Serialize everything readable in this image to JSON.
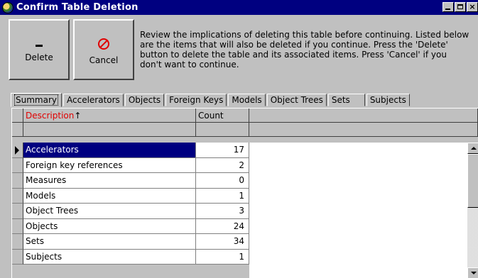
{
  "window": {
    "title": "Confirm Table Deletion"
  },
  "toolbar": {
    "delete_label": "Delete",
    "cancel_label": "Cancel",
    "delete_icon": "dash-icon",
    "cancel_icon": "prohibit-icon"
  },
  "message": "Review the implications of deleting this table before continuing. Listed below are the items that will also be deleted if you continue. Press the 'Delete' button to delete the table and its associated items. Press 'Cancel' if you don't want to continue.",
  "tabs": [
    {
      "label": "Summary",
      "active": true
    },
    {
      "label": "Accelerators"
    },
    {
      "label": "Objects"
    },
    {
      "label": "Foreign Keys"
    },
    {
      "label": "Models"
    },
    {
      "label": "Object Trees"
    },
    {
      "label": "Sets"
    },
    {
      "label": "Subjects"
    }
  ],
  "grid": {
    "columns": {
      "description": "Description",
      "sort_marker": "↑",
      "count": "Count"
    },
    "rows": [
      {
        "description": "Accelerators",
        "count": "17",
        "selected": true
      },
      {
        "description": "Foreign key references",
        "count": "2"
      },
      {
        "description": "Measures",
        "count": "0"
      },
      {
        "description": "Models",
        "count": "1"
      },
      {
        "description": "Object Trees",
        "count": "3"
      },
      {
        "description": "Objects",
        "count": "24"
      },
      {
        "description": "Sets",
        "count": "34"
      },
      {
        "description": "Subjects",
        "count": "1"
      }
    ]
  },
  "colors": {
    "titlebar": "#000080",
    "selection": "#000080",
    "sort_header": "#e00000",
    "face": "#c0c0c0"
  }
}
